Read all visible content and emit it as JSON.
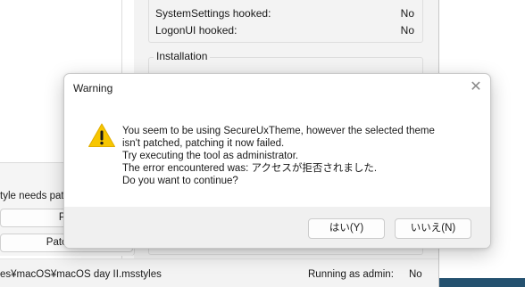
{
  "background_window": {
    "rows": [
      {
        "label": "SystemSettings hooked:",
        "value": "No"
      },
      {
        "label": "LogonUI hooked:",
        "value": "No"
      }
    ],
    "installation_group_title": "Installation",
    "left_panel": {
      "needs_patch_text": "tyle needs patc",
      "buttons": [
        "Pat",
        "Patch an"
      ]
    },
    "status_bar": {
      "theme_path": "es¥macOS¥macOS day II.msstyles",
      "admin_label": "Running as admin:",
      "admin_value": "No"
    }
  },
  "dialog": {
    "title": "Warning",
    "close_glyph": "✕",
    "icon": "warning-triangle-icon",
    "message_lines": [
      "You seem to be using SecureUxTheme, however the selected theme",
      "isn't patched, patching it now failed.",
      "Try executing the tool as administrator.",
      "The error encountered was: アクセスが拒否されました.",
      "Do you want to continue?"
    ],
    "buttons": {
      "yes": "はい(Y)",
      "no": "いいえ(N)"
    }
  },
  "colors": {
    "warning_yellow": "#f7c600",
    "dialog_footer": "#f0f0f0",
    "window_background": "#f3f3f3",
    "desktop_accent": "#24516f"
  }
}
